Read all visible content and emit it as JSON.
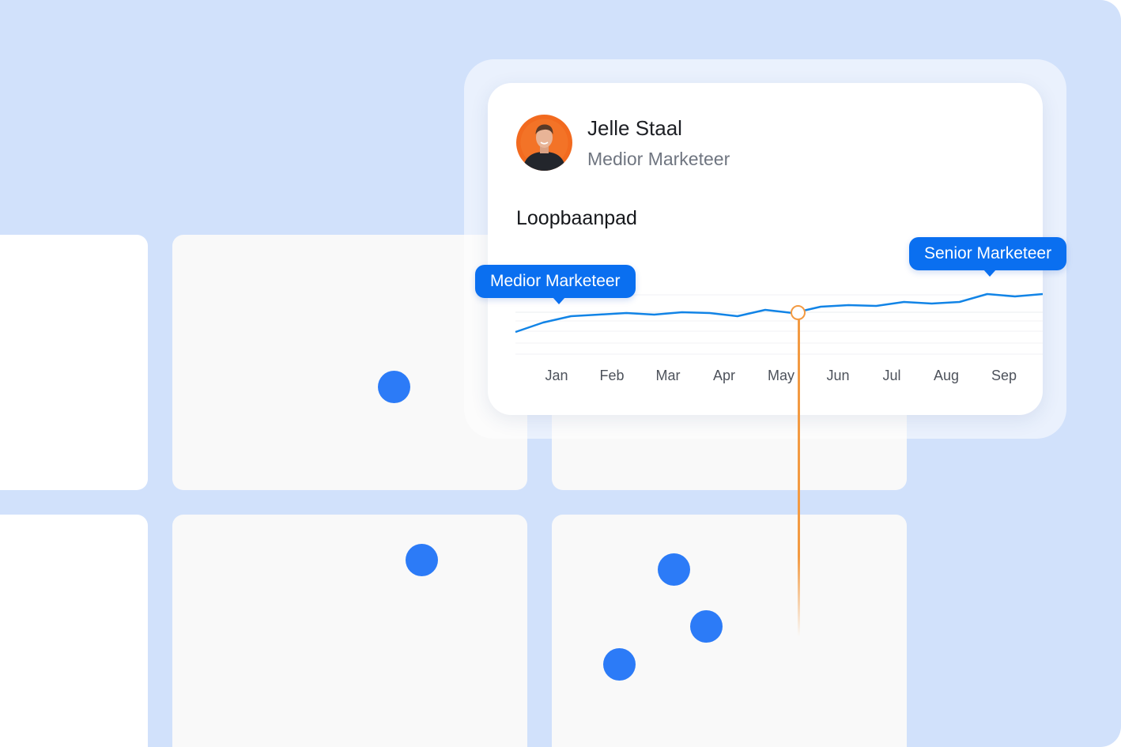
{
  "profile": {
    "name": "Jelle Staal",
    "role": "Medior Marketeer"
  },
  "section": {
    "title": "Loopbaanpad"
  },
  "labels": {
    "start": "Medior Marketeer",
    "end": "Senior Marketeer"
  },
  "colors": {
    "background": "#d1e1fb",
    "line": "#1284e6",
    "marker": "#f39a42",
    "bubble": "#0a6ff0",
    "dot": "#2c7bf7"
  },
  "chart_data": {
    "type": "line",
    "categories": [
      "Jan",
      "Feb",
      "Mar",
      "Apr",
      "May",
      "Jun",
      "Jul",
      "Aug",
      "Sep"
    ],
    "series": [
      {
        "values": [
          0.0,
          0.6,
          1.0,
          1.1,
          1.2,
          1.1,
          1.25,
          1.2,
          1.0,
          1.4,
          1.2,
          1.6,
          1.7,
          1.65,
          1.9,
          1.8,
          1.9,
          2.4,
          2.25,
          2.4
        ]
      }
    ],
    "highlight_index": 8,
    "ylim": [
      -1.5,
      3.0
    ],
    "grid": true
  }
}
